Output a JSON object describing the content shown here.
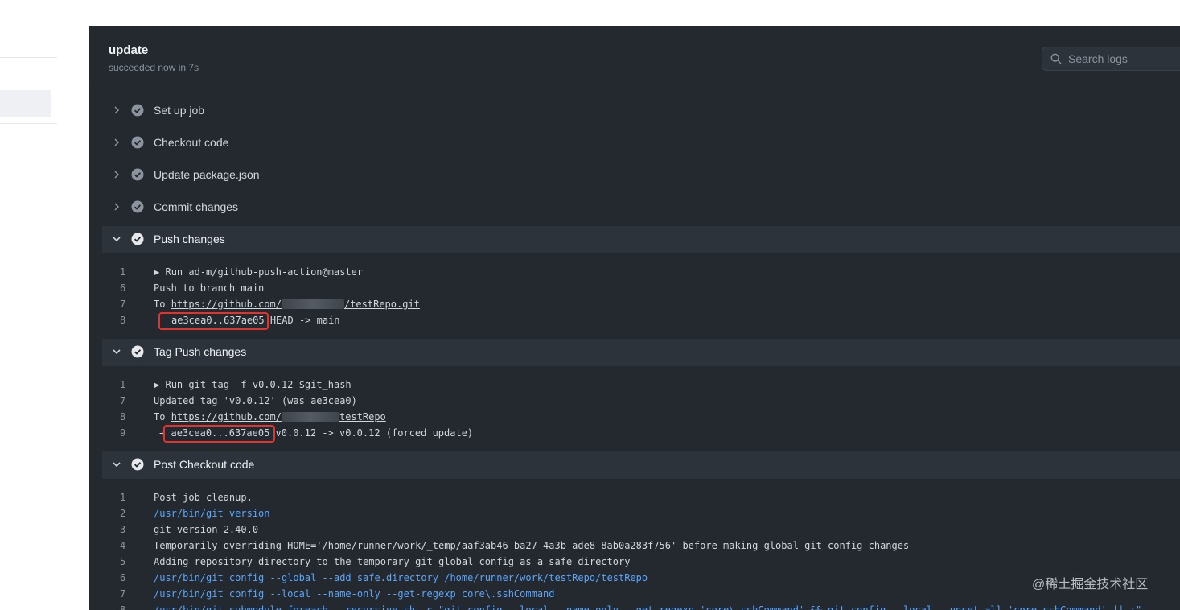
{
  "job": {
    "title": "update",
    "status": "succeeded now in 7s"
  },
  "search": {
    "placeholder": "Search logs",
    "icon": "search-icon"
  },
  "steps": [
    {
      "label": "Set up job",
      "expanded": false
    },
    {
      "label": "Checkout code",
      "expanded": false
    },
    {
      "label": "Update package.json",
      "expanded": false
    },
    {
      "label": "Commit changes",
      "expanded": false
    },
    {
      "label": "Push changes",
      "expanded": true
    },
    {
      "label": "Tag Push changes",
      "expanded": true
    },
    {
      "label": "Post Checkout code",
      "expanded": true
    }
  ],
  "push_logs": [
    {
      "n": "1",
      "marker": "▶",
      "text": "Run ad-m/github-push-action@master"
    },
    {
      "n": "6",
      "text": "Push to branch main"
    },
    {
      "n": "7",
      "prefix": "To ",
      "link": "https://github.com/",
      "suffix": "/testRepo.git"
    },
    {
      "n": "8",
      "hash": "ae3cea0..637ae05",
      "rest": " HEAD -> main"
    }
  ],
  "tag_logs": [
    {
      "n": "1",
      "marker": "▶",
      "text": "Run git tag -f v0.0.12 $git_hash"
    },
    {
      "n": "7",
      "text": "Updated tag 'v0.0.12' (was ae3cea0)"
    },
    {
      "n": "8",
      "prefix": "To ",
      "link": "https://github.com/",
      "suffix": "testRepo"
    },
    {
      "n": "9",
      "plus": "+",
      "hash": "ae3cea0...637ae05",
      "rest": " v0.0.12 -> v0.0.12 (forced update)"
    }
  ],
  "post_logs": [
    {
      "n": "1",
      "text": "Post job cleanup."
    },
    {
      "n": "2",
      "text": "/usr/bin/git version"
    },
    {
      "n": "3",
      "text": "git version 2.40.0"
    },
    {
      "n": "4",
      "text": "Temporarily overriding HOME='/home/runner/work/_temp/aaf3ab46-ba27-4a3b-ade8-8ab0a283f756' before making global git config changes"
    },
    {
      "n": "5",
      "text": "Adding repository directory to the temporary git global config as a safe directory"
    },
    {
      "n": "6",
      "text": "/usr/bin/git config --global --add safe.directory /home/runner/work/testRepo/testRepo"
    },
    {
      "n": "7",
      "text": "/usr/bin/git config --local --name-only --get-regexp core\\.sshCommand"
    },
    {
      "n": "8",
      "text": "/usr/bin/git submodule foreach --recursive sh -c \"git config --local --name-only --get-regexp 'core\\.sshCommand' && git config --local --unset-all 'core.sshCommand' || :\""
    }
  ],
  "watermark": "@稀土掘金技术社区",
  "colors": {
    "panel_bg": "#24292f",
    "command_blue": "#58a6ff",
    "highlight_red": "#e5322d"
  }
}
